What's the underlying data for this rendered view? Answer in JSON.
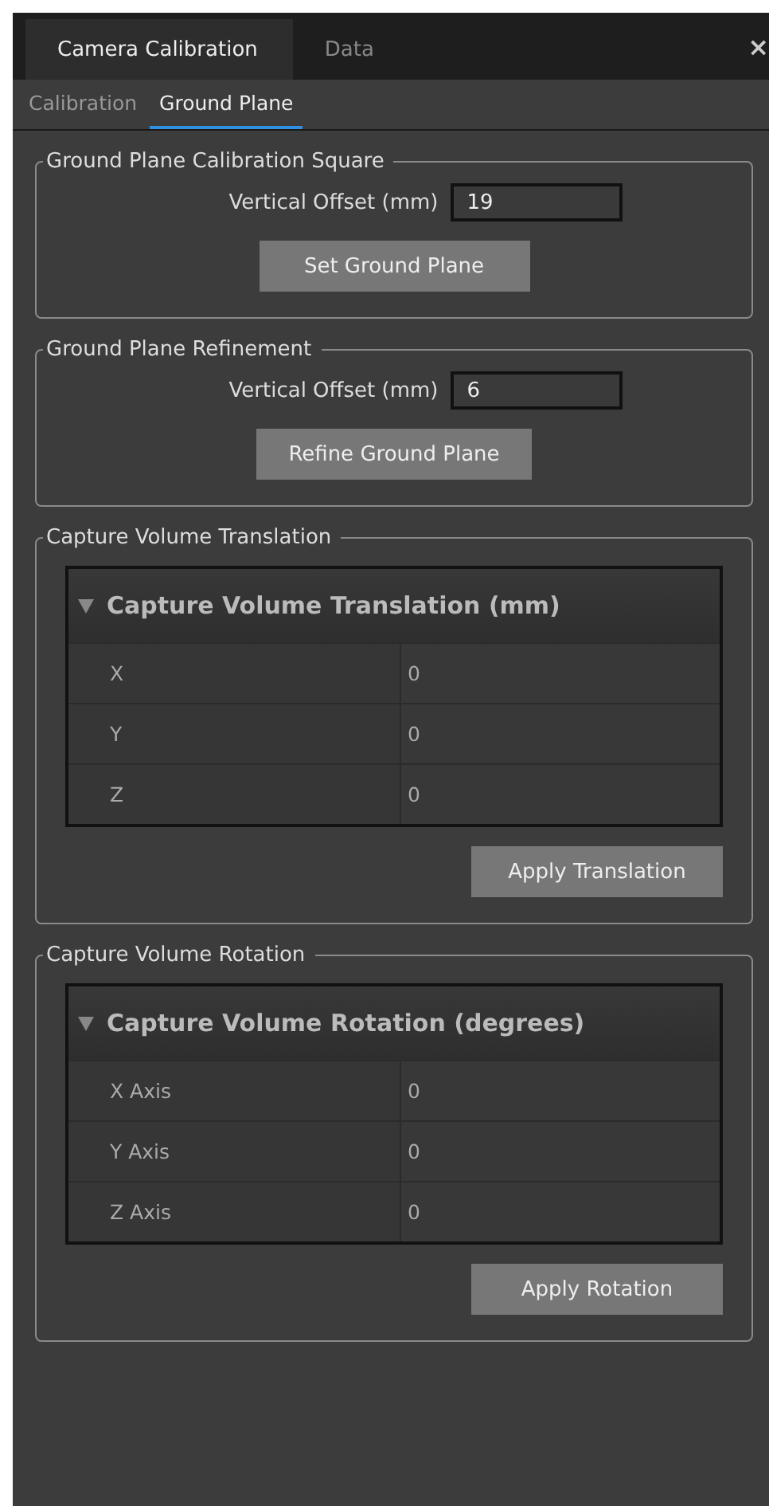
{
  "tabs": [
    {
      "label": "Camera Calibration",
      "selected": true
    },
    {
      "label": "Data",
      "selected": false
    }
  ],
  "close": "×",
  "subtabs": [
    {
      "label": "Calibration",
      "selected": false
    },
    {
      "label": "Ground Plane",
      "selected": true
    }
  ],
  "groups": [
    {
      "kind": "offset",
      "title": "Ground Plane Calibration Square",
      "field": {
        "label": "Vertical Offset (mm)",
        "value": "19"
      },
      "button": "Set Ground Plane"
    },
    {
      "kind": "offset",
      "title": "Ground Plane Refinement",
      "field": {
        "label": "Vertical Offset (mm)",
        "value": "6"
      },
      "button": "Refine Ground Plane"
    },
    {
      "kind": "table",
      "title": "Capture Volume Translation",
      "table": {
        "title": "Capture Volume Translation (mm)",
        "expanded": true,
        "rows": [
          {
            "name": "X",
            "value": "0"
          },
          {
            "name": "Y",
            "value": "0"
          },
          {
            "name": "Z",
            "value": "0"
          }
        ]
      },
      "button": "Apply Translation"
    },
    {
      "kind": "table",
      "title": "Capture Volume Rotation",
      "table": {
        "title": "Capture Volume Rotation (degrees)",
        "expanded": true,
        "rows": [
          {
            "name": "X Axis",
            "value": "0"
          },
          {
            "name": "Y Axis",
            "value": "0"
          },
          {
            "name": "Z Axis",
            "value": "0"
          }
        ]
      },
      "button": "Apply Rotation"
    }
  ]
}
